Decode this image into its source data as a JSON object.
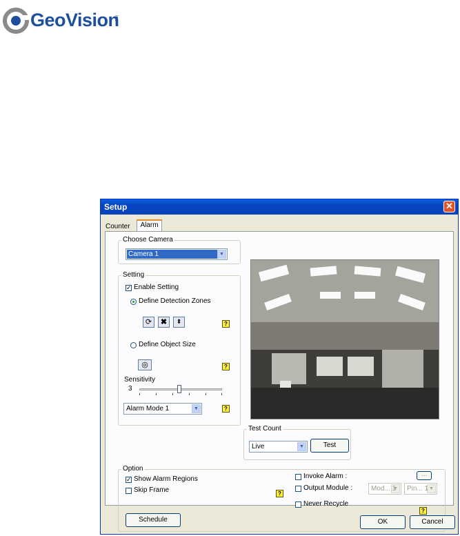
{
  "logo": {
    "name": "GeoVision",
    "suffix": "inc"
  },
  "window": {
    "title": "Setup",
    "close_glyph": "✕",
    "tabs": [
      {
        "label": "Counter"
      },
      {
        "label": "Alarm"
      }
    ],
    "choose_camera": {
      "legend": "Choose Camera",
      "value": "Camera 1"
    },
    "setting": {
      "legend": "Setting",
      "enable_setting": {
        "label": "Enable Setting",
        "checked": true
      },
      "define_detection_zones": {
        "label": "Define Detection Zones",
        "selected": true
      },
      "define_object_size": {
        "label": "Define Object Size",
        "selected": false
      },
      "sensitivity_label": "Sensitivity",
      "sensitivity_value": "3",
      "alarm_mode": "Alarm Mode 1",
      "icons": [
        "refresh-icon",
        "delete-icon",
        "resize-icon",
        "object-size-icon"
      ]
    },
    "test_count": {
      "legend": "Test Count",
      "mode": "Live",
      "test_button": "Test"
    },
    "option": {
      "legend": "Option",
      "show_alarm_regions": {
        "label": "Show Alarm Regions",
        "checked": true
      },
      "skip_frame": {
        "label": "Skip Frame",
        "checked": false
      },
      "invoke_alarm": {
        "label": "Invoke Alarm :",
        "checked": false,
        "browse": "..."
      },
      "output_module": {
        "label": "Output Module :",
        "checked": false,
        "module": "Mod... 1",
        "pin": "Pin... 1"
      },
      "never_recycle": {
        "label": "Never Recycle",
        "checked": false
      },
      "schedule_button": "Schedule"
    },
    "help_glyph": "?",
    "ok_button": "OK",
    "cancel_button": "Cancel",
    "colors": {
      "titlebar": "#0a5fd8",
      "close": "#e0532b",
      "logo": "#1d4f9c",
      "help": "#ffef3a"
    }
  }
}
